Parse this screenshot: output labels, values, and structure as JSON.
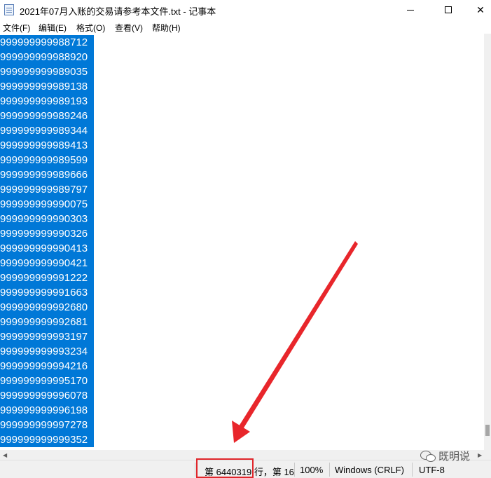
{
  "window": {
    "title": "2021年07月入账的交易请参考本文件.txt - 记事本",
    "minimize_glyph": "—",
    "maximize_glyph": "☐",
    "close_glyph": "✕"
  },
  "menu": {
    "items": [
      {
        "label": "文件(F)"
      },
      {
        "label": "编辑(E)"
      },
      {
        "label": "格式(O)"
      },
      {
        "label": "查看(V)"
      },
      {
        "label": "帮助(H)"
      }
    ]
  },
  "editor": {
    "lines": [
      "999999999988712",
      "999999999988920",
      "999999999989035",
      "999999999989138",
      "999999999989193",
      "999999999989246",
      "999999999989344",
      "999999999989413",
      "999999999989599",
      "999999999989666",
      "999999999989797",
      "999999999990075",
      "999999999990303",
      "999999999990326",
      "999999999990413",
      "999999999990421",
      "999999999991222",
      "999999999991663",
      "999999999992680",
      "999999999992681",
      "999999999993197",
      "999999999993234",
      "999999999994216",
      "999999999995170",
      "999999999996078",
      "999999999996198",
      "999999999997278",
      "999999999999352"
    ],
    "selection_color": "#0078d7"
  },
  "statusbar": {
    "position": "第 6440319 行，第 16",
    "zoom": "100%",
    "line_ending": "Windows (CRLF)",
    "encoding": "UTF-8"
  },
  "annotation": {
    "highlight_color": "#e0262b"
  },
  "watermark": {
    "text": "既明说"
  }
}
